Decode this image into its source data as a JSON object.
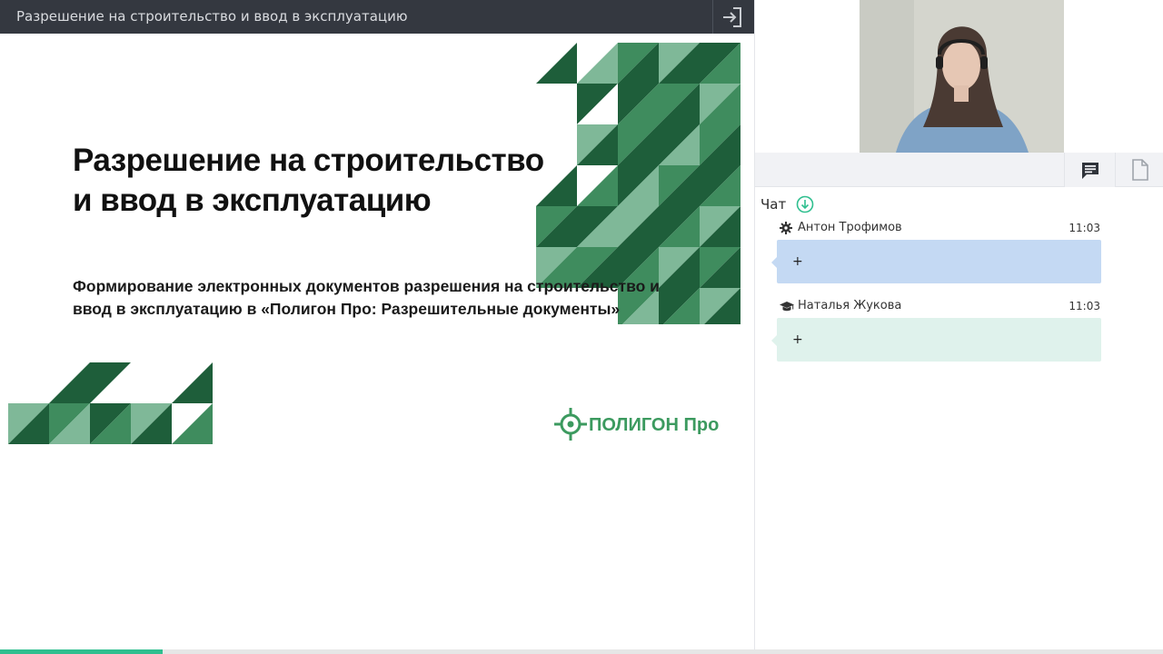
{
  "window": {
    "title": "Разрешение на строительство и ввод в эксплуатацию"
  },
  "slide": {
    "title_line1": "Разрешение на строительство",
    "title_line2": "и ввод в эксплуатацию",
    "subtitle_line1": "Формирование электронных документов разрешения на строительство и",
    "subtitle_line2": "ввод в эксплуатацию в «Полигон Про: Разрешительные документы»",
    "logo_text": "ПОЛИГОН Про"
  },
  "chat": {
    "label": "Чат",
    "messages": [
      {
        "author": "Антон Трофимов",
        "time": "11:03",
        "text": "+",
        "icon": "gear-icon"
      },
      {
        "author": "Наталья Жукова",
        "time": "11:03",
        "text": "+",
        "icon": "graduation-cap-icon"
      }
    ]
  },
  "progress": {
    "fraction": 0.14
  },
  "colors": {
    "topbar": "#343840",
    "accent_green": "#2fbf8f",
    "bubble_blue": "#c4d9f3",
    "bubble_green": "#dff2ec",
    "pattern_dark": "#1e5e3a",
    "pattern_mid": "#3f8c5e",
    "pattern_light": "#7fb898"
  }
}
